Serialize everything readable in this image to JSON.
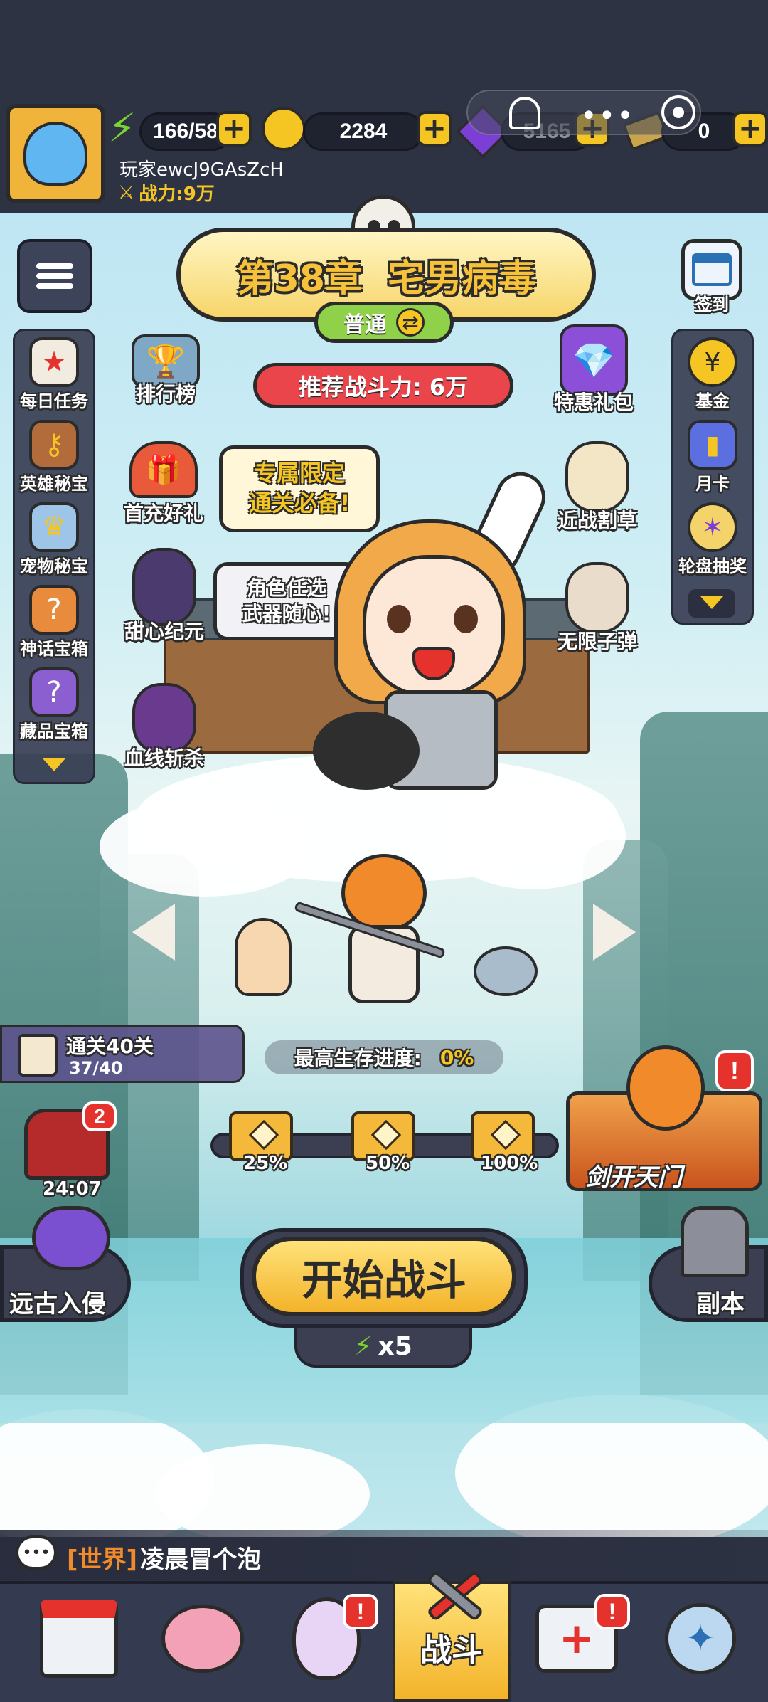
{
  "player": {
    "name": "玩家ewcJ9GAsZcH",
    "power": "战力:9万"
  },
  "resources": {
    "energy": "166/58",
    "gold": "2284",
    "gems": "5165",
    "tickets": "0"
  },
  "chapter": {
    "title": "第38章  宅男病毒",
    "mode": "普通",
    "recommended_power": "推荐战斗力: 6万"
  },
  "left_column": [
    {
      "icon": "daily-task-icon",
      "label": "每日任务"
    },
    {
      "icon": "hero-treasure-icon",
      "label": "英雄秘宝"
    },
    {
      "icon": "pet-treasure-icon",
      "label": "宠物秘宝"
    },
    {
      "icon": "myth-chest-icon",
      "label": "神话宝箱"
    },
    {
      "icon": "collection-chest-icon",
      "label": "藏品宝箱"
    }
  ],
  "right_column": [
    {
      "icon": "fund-icon",
      "label": "基金"
    },
    {
      "icon": "month-card-icon",
      "label": "月卡"
    },
    {
      "icon": "wheel-icon",
      "label": "轮盘抽奖"
    }
  ],
  "events_left": [
    {
      "label": "排行榜"
    },
    {
      "label": "首充好礼"
    },
    {
      "label": "甜心纪元"
    },
    {
      "label": "血线斩杀"
    }
  ],
  "events_right": [
    {
      "label": "特惠礼包"
    },
    {
      "label": "近战割草"
    },
    {
      "label": "无限子弹"
    }
  ],
  "speech_bubbles": {
    "bubble1": "专属限定\n通关必备!",
    "bubble2": "角色任选\n武器随心!"
  },
  "signin": {
    "label": "签到"
  },
  "clear_task": {
    "title": "通关40关",
    "progress": "37/40"
  },
  "survival": {
    "label": "最高生存进度:",
    "value": "0%"
  },
  "milestones": [
    "25%",
    "50%",
    "100%"
  ],
  "gift_timer": {
    "count": "2",
    "time": "24:07"
  },
  "promo": {
    "label": "剑开天门",
    "alert": "!"
  },
  "start_battle": {
    "label": "开始战斗",
    "cost": "x5"
  },
  "ancient_invasion": {
    "label": "远古入侵"
  },
  "dungeon": {
    "label": "副本"
  },
  "chat": {
    "channel": "[世界]",
    "message": "凌晨冒个泡"
  },
  "bottom_nav": [
    {
      "icon": "shop-icon",
      "label": ""
    },
    {
      "icon": "nurse-brain-icon",
      "label": ""
    },
    {
      "icon": "egg-icon",
      "label": "",
      "alert": "!"
    },
    {
      "icon": "battle-icon",
      "label": "战斗",
      "active": true
    },
    {
      "icon": "medkit-icon",
      "label": "",
      "alert": "!"
    },
    {
      "icon": "badge-icon",
      "label": ""
    }
  ],
  "colors": {
    "accent_yellow": "#f5c524",
    "dark_panel": "#2e3344",
    "alert_red": "#e5322d",
    "chat_channel": "#f08a2a"
  }
}
